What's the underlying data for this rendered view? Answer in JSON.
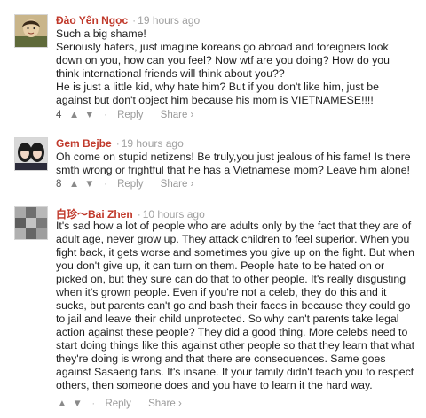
{
  "comments": [
    {
      "author": "Đào Yến Ngọc",
      "time": "19 hours ago",
      "body": [
        "Such a big shame!",
        "Seriously haters, just imagine koreans go abroad and foreigners look down on you, how can you feel? Now wtf are you doing? How do you think international friends will think about you??",
        "He is just a little kid, why hate him? But if you don't like him, just be against but don't object him because his mom is VIETNAMESE!!!!"
      ],
      "votes": "4",
      "reply": "Reply",
      "share": "Share ›",
      "avatar": "drawn-portrait-avatar"
    },
    {
      "author": "Gem Bejbe",
      "time": "19 hours ago",
      "body": [
        "Oh come on stupid netizens! Be truly,you just jealous of his fame! Is there smth wrong or frightful that he has a Vietnamese mom? Leave him alone!"
      ],
      "votes": "8",
      "reply": "Reply",
      "share": "Share ›",
      "avatar": "two-girls-photo-avatar"
    },
    {
      "author": "白珍～Bai Zhen",
      "time": "10 hours ago",
      "body": [
        "It's sad how a lot of people who are adults only by the fact that they are of adult age, never grow up. They attack children to feel superior. When you fight back, it gets worse and sometimes you give up on the fight. But when you don't give up, it can turn on them. People hate to be hated on or picked on, but they sure can do that to other people. It's really disgusting when it's grown people. Even if you're not a celeb, they do this and it sucks, but parents can't go and bash their faces in because they could go to jail and leave their child unprotected. So why can't parents take legal action against these people? They did a good thing. More celebs need to start doing things like this against other people so that they learn that what they're doing is wrong and that there are consequences. Same goes against Sasaeng fans. It's insane. If your family didn't teach you to respect others, then someone does and you have to learn it the hard way."
      ],
      "votes": "",
      "reply": "Reply",
      "share": "Share ›",
      "avatar": "blurred-image-avatar"
    }
  ],
  "icons": {
    "separator": "·",
    "upvote": "▲",
    "downvote": "▼"
  }
}
